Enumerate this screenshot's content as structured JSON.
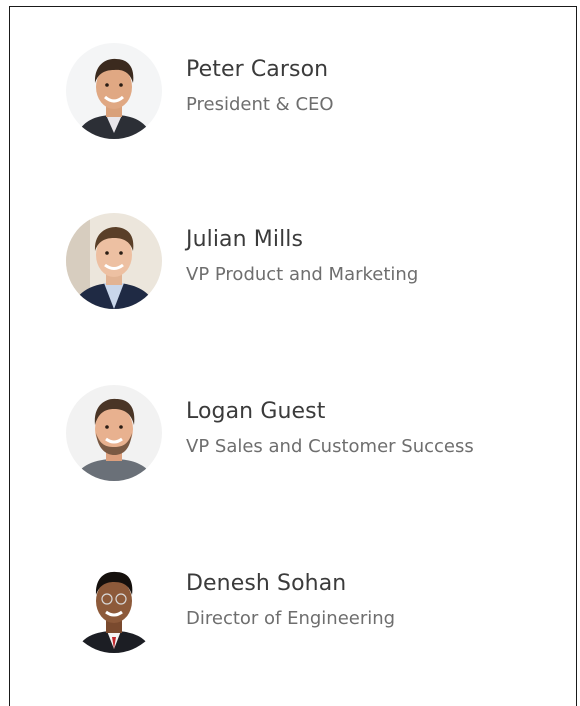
{
  "team": {
    "members": [
      {
        "name": "Peter Carson",
        "title": "President & CEO",
        "avatar_icon": "person-photo"
      },
      {
        "name": "Julian Mills",
        "title": "VP Product and Marketing",
        "avatar_icon": "person-photo"
      },
      {
        "name": "Logan Guest",
        "title": "VP Sales and Customer Success",
        "avatar_icon": "person-photo"
      },
      {
        "name": "Denesh Sohan",
        "title": "Director of Engineering",
        "avatar_icon": "person-photo"
      }
    ]
  }
}
